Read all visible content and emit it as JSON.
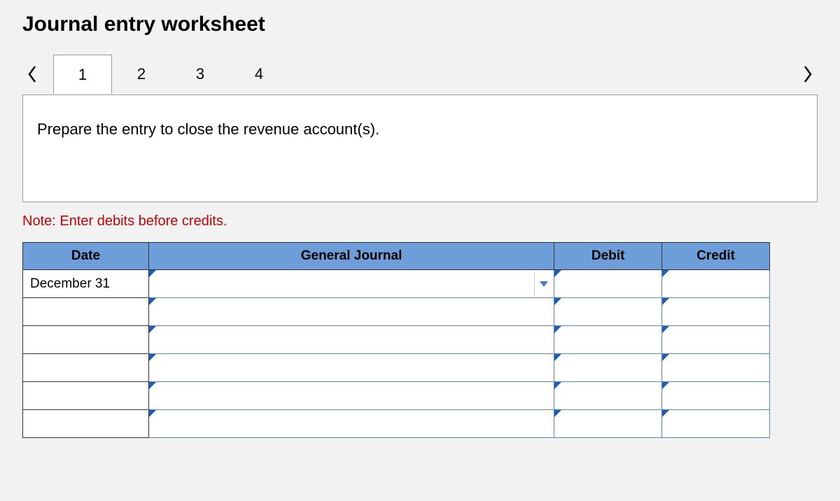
{
  "title": "Journal entry worksheet",
  "tabs": [
    "1",
    "2",
    "3",
    "4"
  ],
  "active_tab_index": 0,
  "instruction": "Prepare the entry to close the revenue account(s).",
  "note": "Note: Enter debits before credits.",
  "table": {
    "headers": {
      "date": "Date",
      "journal": "General Journal",
      "debit": "Debit",
      "credit": "Credit"
    },
    "rows": [
      {
        "date": "December 31",
        "journal": "",
        "debit": "",
        "credit": "",
        "show_dropdown": true
      },
      {
        "date": "",
        "journal": "",
        "debit": "",
        "credit": "",
        "show_dropdown": false
      },
      {
        "date": "",
        "journal": "",
        "debit": "",
        "credit": "",
        "show_dropdown": false
      },
      {
        "date": "",
        "journal": "",
        "debit": "",
        "credit": "",
        "show_dropdown": false
      },
      {
        "date": "",
        "journal": "",
        "debit": "",
        "credit": "",
        "show_dropdown": false
      },
      {
        "date": "",
        "journal": "",
        "debit": "",
        "credit": "",
        "show_dropdown": false
      }
    ]
  }
}
